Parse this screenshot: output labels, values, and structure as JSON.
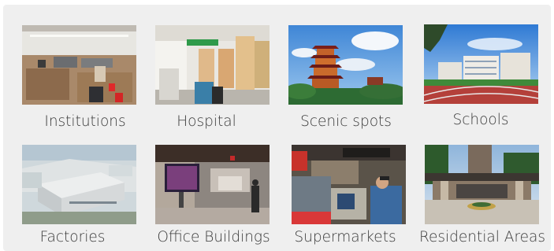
{
  "tiles": [
    {
      "label": "Institutions",
      "icon": "government-service-hall-photo"
    },
    {
      "label": "Hospital",
      "icon": "hospital-lobby-photo"
    },
    {
      "label": "Scenic spots",
      "icon": "pagoda-tower-photo"
    },
    {
      "label": "Schools",
      "icon": "school-campus-photo"
    },
    {
      "label": "Factories",
      "icon": "factory-aerial-photo"
    },
    {
      "label": "Office Buildings",
      "icon": "office-lobby-photo"
    },
    {
      "label": "Supermarkets",
      "icon": "supermarket-checkout-photo"
    },
    {
      "label": "Residential Areas",
      "icon": "residential-gate-photo"
    }
  ]
}
